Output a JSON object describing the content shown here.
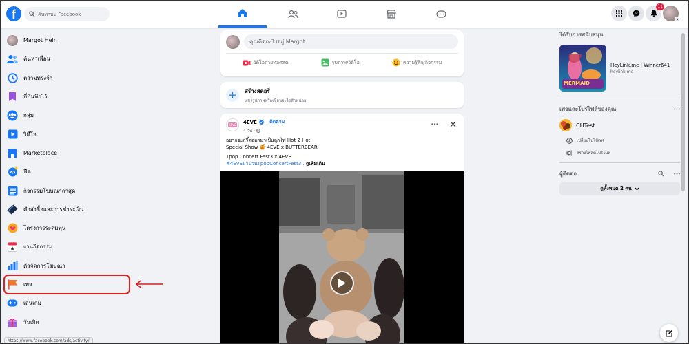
{
  "header": {
    "logo_text": "f",
    "search_placeholder": "ค้นหาบน Facebook",
    "nav_tabs": [
      {
        "icon": "home-icon",
        "active": true
      },
      {
        "icon": "friends-icon",
        "active": false
      },
      {
        "icon": "watch-icon",
        "active": false
      },
      {
        "icon": "marketplace-icon",
        "active": false
      },
      {
        "icon": "gaming-icon",
        "active": false
      }
    ],
    "notification_count": "11"
  },
  "sidebar": {
    "items": [
      {
        "label": "Margot Hein",
        "icon": "profile-avatar"
      },
      {
        "label": "ค้นหาเพื่อน",
        "icon": "friends-icon"
      },
      {
        "label": "ความทรงจำ",
        "icon": "memories-icon"
      },
      {
        "label": "ที่บันทึกไว้",
        "icon": "saved-icon"
      },
      {
        "label": "กลุ่ม",
        "icon": "groups-icon"
      },
      {
        "label": "วิดีโอ",
        "icon": "video-icon"
      },
      {
        "label": "Marketplace",
        "icon": "marketplace-icon"
      },
      {
        "label": "ฟีด",
        "icon": "feeds-icon"
      },
      {
        "label": "กิจกรรมโฆษณาล่าสุด",
        "icon": "ad-activity-icon"
      },
      {
        "label": "คำสั่งซื้อและการชำระเงิน",
        "icon": "payments-icon"
      },
      {
        "label": "โครงการระดมทุน",
        "icon": "fundraisers-icon"
      },
      {
        "label": "งานกิจกรรม",
        "icon": "events-icon"
      },
      {
        "label": "ตัวจัดการโฆษณา",
        "icon": "ads-manager-icon"
      },
      {
        "label": "เพจ",
        "icon": "pages-flag-icon"
      },
      {
        "label": "เล่นเกม",
        "icon": "gaming-icon"
      },
      {
        "label": "วันเกิด",
        "icon": "birthday-icon"
      }
    ],
    "status_url": "https://www.facebook.com/ads/activity/"
  },
  "composer": {
    "placeholder": "คุณคิดอะไรอยู่ Margot",
    "actions": [
      {
        "label": "วิดีโอถ่ายทอดสด",
        "icon": "live-video-icon",
        "color": "#f02849"
      },
      {
        "label": "รูปภาพ/วิดีโอ",
        "icon": "photo-icon",
        "color": "#45bd62"
      },
      {
        "label": "ความรู้สึก/กิจกรรม",
        "icon": "feeling-icon",
        "color": "#f7b928"
      }
    ]
  },
  "story": {
    "title": "สร้างสตอรี่",
    "subtitle": "แชร์รูปภาพหรือเขียนอะไรสักหน่อย"
  },
  "post": {
    "page_name": "4EVE",
    "follow_label": "ติดตาม",
    "time": "4 วัน",
    "logo_text": "4EVE",
    "text_line1": "อยากจะกรี๊ดออกมาเป็นลูกไฟ Hot 2 Hot",
    "text_line2": "Special Show 🍯 4EVE x BUTTERBEAR",
    "text_line3": "Tpop Concert Fest3 x 4EVE",
    "hashtag": "#4EVEมาป่วนTpopConcertFest3..",
    "see_more": "ดูเพิ่มเติม"
  },
  "right": {
    "sponsored_title": "ได้รับการสนับสนุน",
    "ad_name": "HeyLink.me | Winner641",
    "ad_domain": "heylink.me",
    "ad_image_text": "MERMAID",
    "pages_title": "เพจและโปรไฟล์ของคุณ",
    "page_name": "CHTest",
    "switch_label": "เปลี่ยนไปใช้เพจ",
    "promote_label": "สร้างโพสต์โปรโมท",
    "contacts_title": "ผู้ติดต่อ",
    "see_all_label": "ดูทั้งหมด 2 คน"
  },
  "colors": {
    "accent": "#1877f2",
    "highlight": "#e02020",
    "badge": "#e41e3f"
  }
}
